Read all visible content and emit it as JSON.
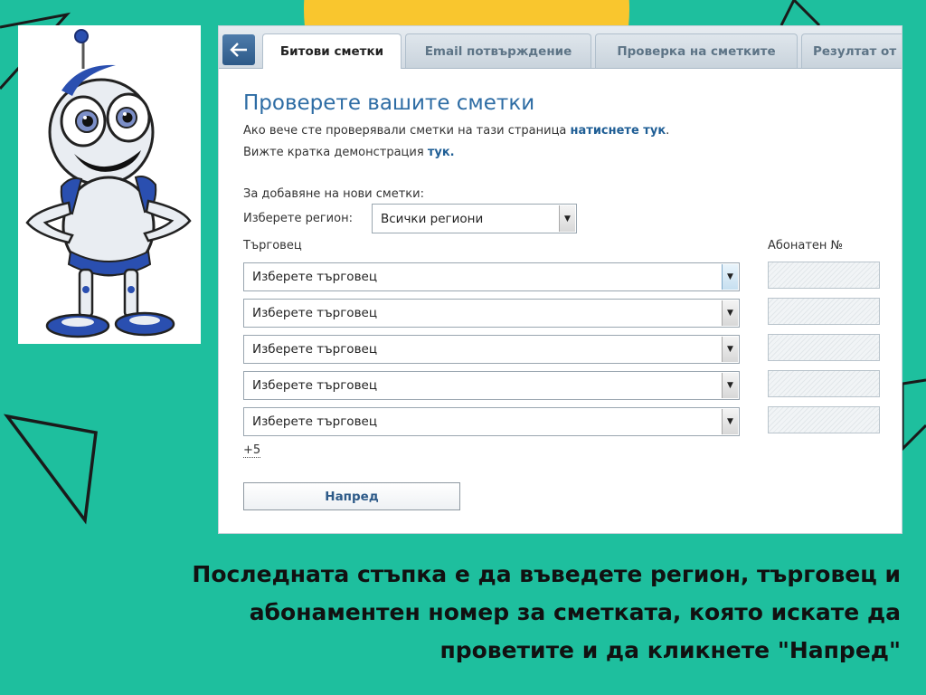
{
  "tabs": [
    {
      "label": "Битови сметки",
      "active": true
    },
    {
      "label": "Email потвърждение",
      "active": false
    },
    {
      "label": "Проверка на сметките",
      "active": false
    },
    {
      "label": "Резултат от",
      "active": false
    }
  ],
  "content": {
    "title": "Проверете вашите сметки",
    "line1_text": "Ако вече сте проверявали сметки на тази страница ",
    "line1_link": "натиснете тук",
    "line1_end": ".",
    "line2_text": "Вижте кратка демонстрация ",
    "line2_link": "тук.",
    "add_label": "За добавяне на нови сметки:",
    "region_label": "Изберете регион:",
    "region_value": "Всички региони",
    "merchant_header": "Търговец",
    "subscriber_header": "Абонатен №",
    "merchant_rows": [
      "Изберете търговец",
      "Изберете търговец",
      "Изберете търговец",
      "Изберете търговец",
      "Изберете търговец"
    ],
    "more_link": "+5",
    "next_button": "Напред"
  },
  "caption": {
    "line1": "Последната стъпка е да въведете регион, търговец и",
    "line2": "абонаментен номер за сметката, която искате да",
    "line3": "проветите и да кликнете \"Напред\""
  },
  "colors": {
    "background": "#1ebf9e",
    "accent_yellow": "#f9c62e",
    "title_blue": "#2d6ca4",
    "link_blue": "#1f5e95"
  },
  "icons": {
    "back": "arrow-left-icon",
    "dropdown": "chevron-down-icon",
    "mascot": "robot-mascot"
  }
}
